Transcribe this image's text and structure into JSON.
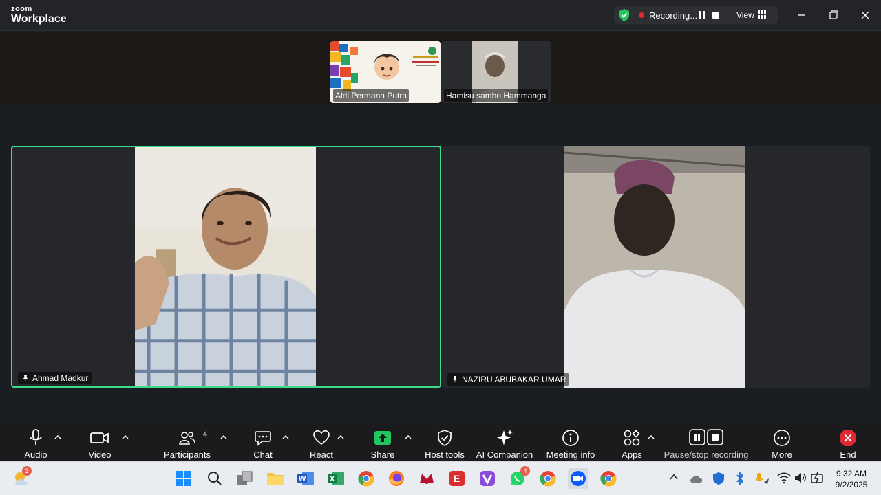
{
  "window": {
    "logo_top": "zoom",
    "logo_bottom": "Workplace",
    "recording_label": "Recording...",
    "view_label": "View"
  },
  "thumbnails": [
    {
      "name": "Aldi Permana Putra"
    },
    {
      "name": "Hamisu sambo Hammanga"
    }
  ],
  "tiles": [
    {
      "name": "Ahmad Madkur",
      "active": true
    },
    {
      "name": "NAZIRU ABUBAKAR UMAR",
      "active": false
    }
  ],
  "toolbar": {
    "audio": "Audio",
    "video": "Video",
    "participants": "Participants",
    "participants_count": "4",
    "chat": "Chat",
    "react": "React",
    "share": "Share",
    "host_tools": "Host tools",
    "ai_companion": "AI Companion",
    "meeting_info": "Meeting info",
    "apps": "Apps",
    "pause_stop": "Pause/stop recording",
    "more": "More",
    "end": "End"
  },
  "taskbar": {
    "weather_badge": "3",
    "whatsapp_badge": "4",
    "time": "9:32 AM",
    "date": "9/2/2025"
  },
  "colors": {
    "accent_green": "#3bdc8a",
    "share_green": "#22c55e",
    "end_red": "#e02a33",
    "recording_red": "#e02a33"
  }
}
